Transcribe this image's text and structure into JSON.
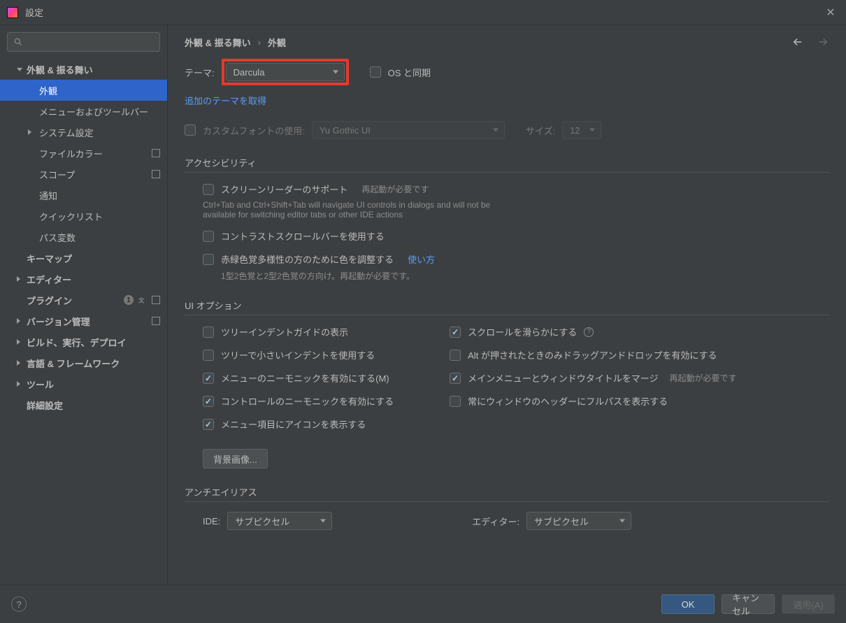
{
  "window": {
    "title": "設定"
  },
  "sidebar": {
    "search_placeholder": "",
    "items": [
      {
        "label": "外観 & 振る舞い"
      },
      {
        "label": "外観"
      },
      {
        "label": "メニューおよびツールバー"
      },
      {
        "label": "システム設定"
      },
      {
        "label": "ファイルカラー"
      },
      {
        "label": "スコープ"
      },
      {
        "label": "通知"
      },
      {
        "label": "クイックリスト"
      },
      {
        "label": "パス変数"
      },
      {
        "label": "キーマップ"
      },
      {
        "label": "エディター"
      },
      {
        "label": "プラグイン",
        "badge": "1"
      },
      {
        "label": "バージョン管理"
      },
      {
        "label": "ビルド、実行、デプロイ"
      },
      {
        "label": "言語 & フレームワーク"
      },
      {
        "label": "ツール"
      },
      {
        "label": "詳細設定"
      }
    ]
  },
  "breadcrumb": {
    "root": "外観 & 振る舞い",
    "leaf": "外観"
  },
  "theme": {
    "label": "テーマ:",
    "value": "Darcula",
    "sync_label": "OS と同期",
    "more_link": "追加のテーマを取得"
  },
  "font": {
    "custom_label": "カスタムフォントの使用:",
    "family": "Yu Gothic UI",
    "size_label": "サイズ:",
    "size": "12"
  },
  "accessibility": {
    "title": "アクセシビリティ",
    "screenreader": "スクリーンリーダーのサポート",
    "restart_note": "再起動が必要です",
    "tab_note": "Ctrl+Tab and Ctrl+Shift+Tab will navigate UI controls in dialogs and will not be available for switching editor tabs or other IDE actions",
    "contrast_scroll": "コントラストスクロールバーを使用する",
    "color_adjust": "赤緑色覚多様性の方のために色を調整する",
    "howto": "使い方",
    "cv_note": "1型2色覚と2型2色覚の方向け。再起動が必要です。"
  },
  "uiopts": {
    "title": "UI オプション",
    "left": [
      {
        "label": "ツリーインデントガイドの表示",
        "checked": false
      },
      {
        "label": "ツリーで小さいインデントを使用する",
        "checked": false
      },
      {
        "label": "メニューのニーモニックを有効にする(M)",
        "checked": true
      },
      {
        "label": "コントロールのニーモニックを有効にする",
        "checked": true
      },
      {
        "label": "メニュー項目にアイコンを表示する",
        "checked": true
      }
    ],
    "right": [
      {
        "label": "スクロールを滑らかにする",
        "checked": true,
        "help": true
      },
      {
        "label": "Alt が押されたときのみドラッグアンドドロップを有効にする",
        "checked": false
      },
      {
        "label": "メインメニューとウィンドウタイトルをマージ",
        "checked": true,
        "note": "再起動が必要です"
      },
      {
        "label": "常にウィンドウのヘッダーにフルパスを表示する",
        "checked": false
      }
    ],
    "bg_button": "背景画像..."
  },
  "antialias": {
    "title": "アンチエイリアス",
    "ide_label": "IDE:",
    "ide_value": "サブピクセル",
    "editor_label": "エディター:",
    "editor_value": "サブピクセル"
  },
  "footer": {
    "ok": "OK",
    "cancel": "キャンセル",
    "apply": "適用(A)"
  }
}
